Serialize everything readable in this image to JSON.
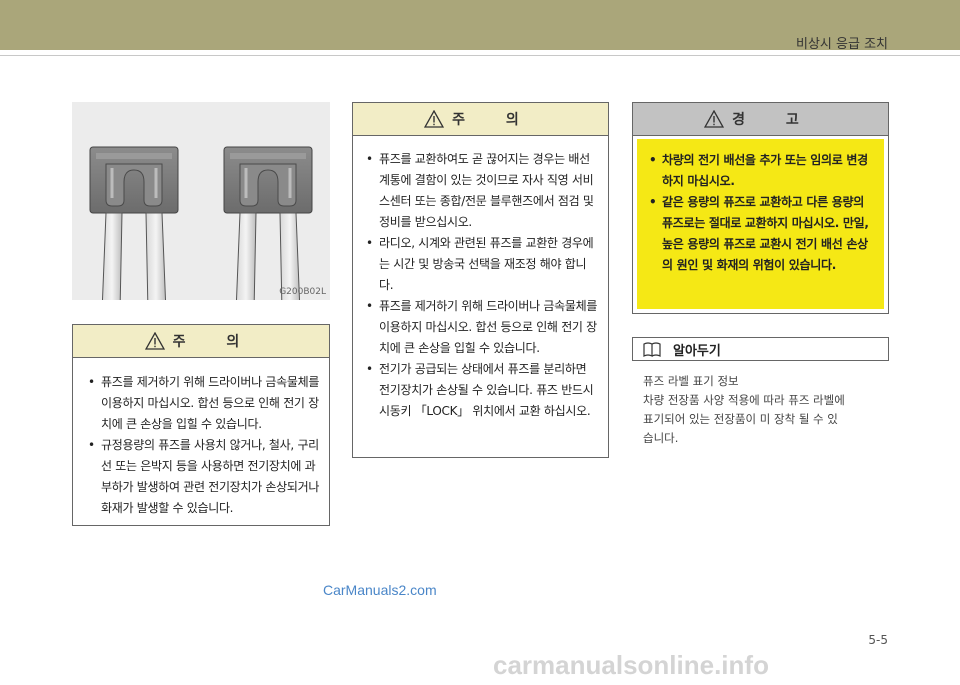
{
  "header": {
    "title": "비상시 응급 조치"
  },
  "figure": {
    "code": "G200B02L"
  },
  "caution_left": {
    "title": "주 의",
    "items": [
      "퓨즈를 제거하기 위해 드라이버나 금속물체를 이용하지 마십시오. 합선 등으로 인해 전기 장치에 큰 손상을 입힐 수 있습니다.",
      "규정용량의 퓨즈를 사용치 않거나, 철사, 구리선 또는 은박지 등을 사용하면 전기장치에 과부하가 발생하여 관련 전기장치가 손상되거나 화재가 발생할 수 있습니다."
    ]
  },
  "caution_mid": {
    "title": "주 의",
    "items": [
      "퓨즈를 교환하여도 곧 끊어지는 경우는 배선 계통에 결함이 있는 것이므로 자사 직영 서비스센터 또는 종합/전문 블루핸즈에서 점검 및 정비를 받으십시오.",
      "라디오, 시계와 관련된 퓨즈를 교환한 경우에는 시간 및 방송국 선택을 재조정 해야 합니다.",
      "퓨즈를 제거하기 위해 드라이버나 금속물체를 이용하지 마십시오. 합선 등으로 인해 전기 장치에 큰 손상을 입힐 수 있습니다.",
      "전기가 공급되는 상태에서 퓨즈를 분리하면 전기장치가 손상될 수 있습니다. 퓨즈 반드시 시동키 「LOCK」 위치에서 교환 하십시오."
    ]
  },
  "warning": {
    "title": "경 고",
    "items": [
      "차량의 전기 배선을 추가 또는 임의로 변경하지 마십시오.",
      "같은 용량의 퓨즈로 교환하고 다른 용량의 퓨즈로는 절대로 교환하지 마십시오. 만일, 높은 용량의 퓨즈로 교환시 전기 배선 손상의 원인 및 화재의 위험이 있습니다."
    ]
  },
  "note": {
    "title": "알아두기",
    "lines": [
      "퓨즈 라벨 표기 정보",
      "차량 전장품 사양 적용에 따라 퓨즈 라벨에",
      "표기되어 있는 전장품이 미 장착 될 수 있",
      "습니다."
    ]
  },
  "watermark": "CarManuals2.com",
  "page_number": "5-5",
  "footer_watermark": "carmanualsonline.info"
}
